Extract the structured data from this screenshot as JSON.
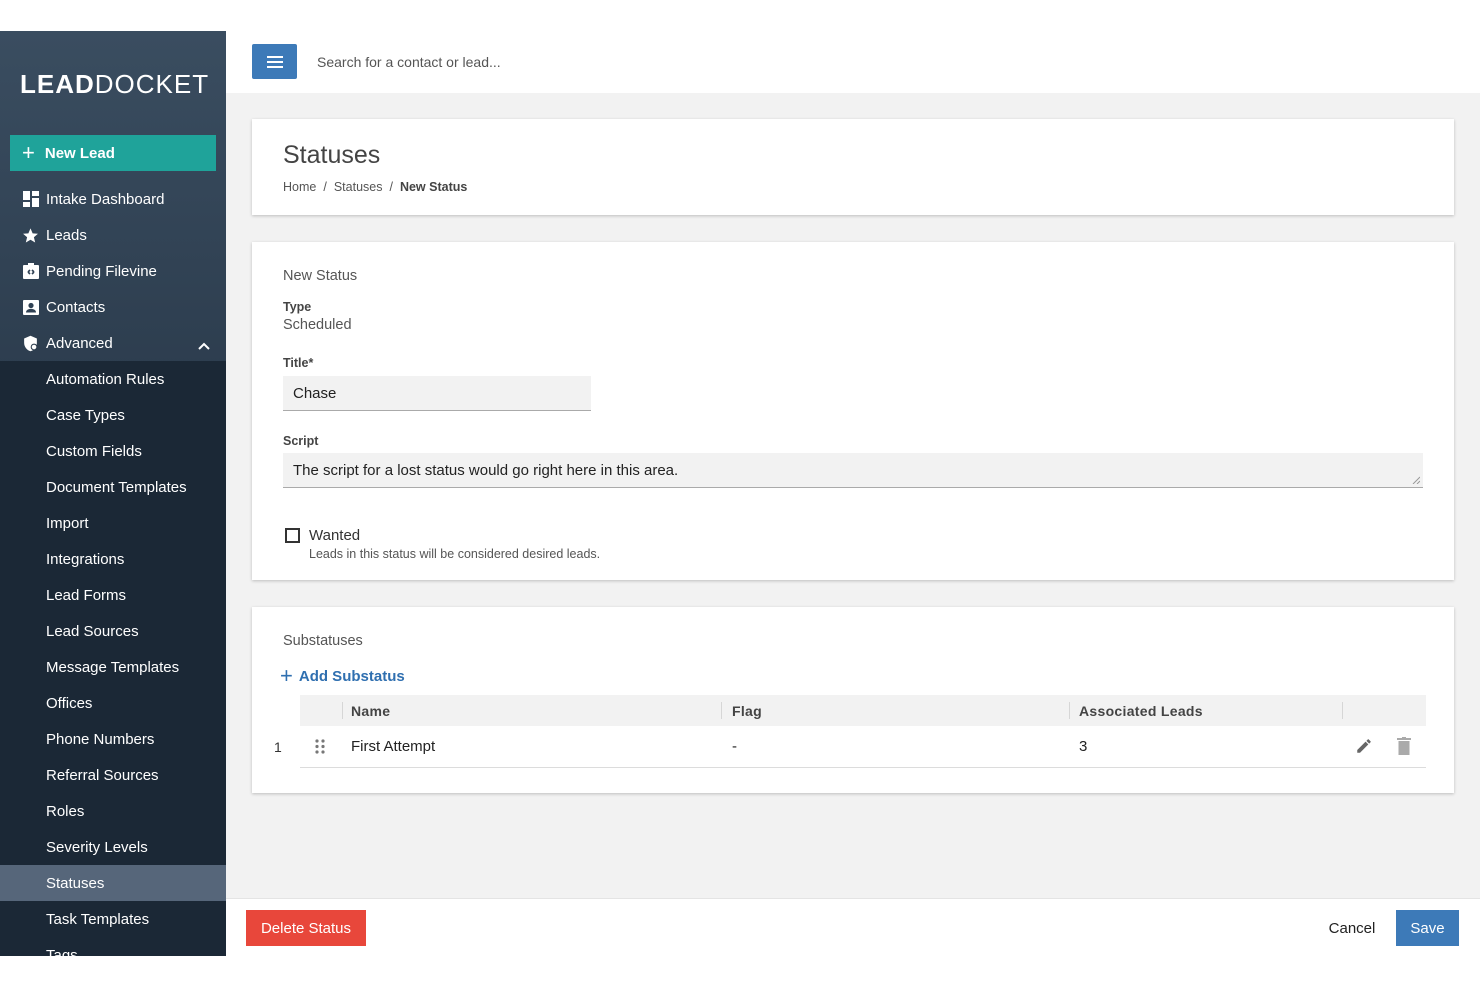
{
  "brand": {
    "logo_bold": "LEAD",
    "logo_thin": "DOCKET"
  },
  "sidebar": {
    "new_lead_label": "New Lead",
    "items": [
      {
        "label": "Intake Dashboard",
        "icon": "dashboard-icon"
      },
      {
        "label": "Leads",
        "icon": "star-icon"
      },
      {
        "label": "Pending Filevine",
        "icon": "filevine-icon"
      },
      {
        "label": "Contacts",
        "icon": "contacts-icon"
      },
      {
        "label": "Advanced",
        "icon": "advanced-shield-icon"
      }
    ],
    "advanced_items": [
      "Automation Rules",
      "Case Types",
      "Custom Fields",
      "Document Templates",
      "Import",
      "Integrations",
      "Lead Forms",
      "Lead Sources",
      "Message Templates",
      "Offices",
      "Phone Numbers",
      "Referral Sources",
      "Roles",
      "Severity Levels",
      "Statuses",
      "Task Templates",
      "Tags"
    ],
    "active_item": "Statuses"
  },
  "topbar": {
    "search_placeholder": "Search for a contact or lead..."
  },
  "header": {
    "title": "Statuses",
    "breadcrumb": [
      "Home",
      "Statuses",
      "New Status"
    ],
    "separator": "/"
  },
  "form": {
    "section_title": "New Status",
    "type_label": "Type",
    "type_value": "Scheduled",
    "title_label": "Title*",
    "title_value": "Chase",
    "script_label": "Script",
    "script_value": "The script for a lost status would go right here in this area.",
    "wanted_label": "Wanted",
    "wanted_help": "Leads in this status will be considered desired leads.",
    "wanted_checked": false
  },
  "substatuses": {
    "section_title": "Substatuses",
    "add_label": "Add Substatus",
    "columns": [
      "Name",
      "Flag",
      "Associated Leads"
    ],
    "rows": [
      {
        "num": "1",
        "name": "First Attempt",
        "flag": "-",
        "leads": "3"
      }
    ]
  },
  "footer": {
    "delete_label": "Delete Status",
    "cancel_label": "Cancel",
    "save_label": "Save"
  },
  "colors": {
    "accent_teal": "#1fa39a",
    "primary_blue": "#3d7ab8",
    "danger_red": "#e8473b",
    "sidebar_dark": "#1b2836"
  }
}
